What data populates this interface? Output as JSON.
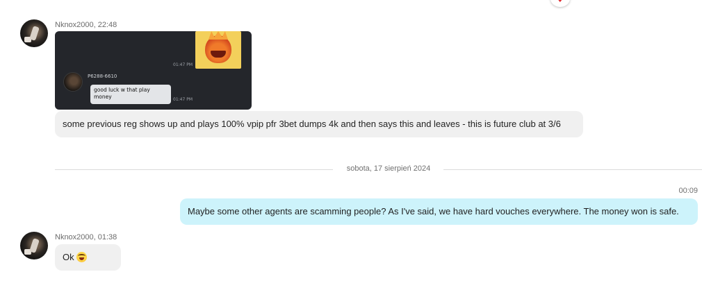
{
  "messages": {
    "first_group": {
      "sender": "Nknox2000, 22:48",
      "screenshot": {
        "time_top": "01:47 PM",
        "inner_name": "P6288-6610",
        "inner_message": "good luck w that play money",
        "time_bottom": "01:47 PM"
      },
      "text": "some previous reg shows up and plays 100% vpip pfr 3bet dumps 4k and then says this and leaves - this is future club at 3/6"
    },
    "date_divider": "sobota, 17 sierpień 2024",
    "outgoing": {
      "time": "00:09",
      "text": "Maybe some other agents are scamming people? As I've said, we have hard vouches everywhere. The money won is safe."
    },
    "second_group": {
      "sender": "Nknox2000, 01:38",
      "text": "Ok"
    }
  },
  "icons": {
    "reaction": "heart-reaction-icon",
    "emoji": "grinning-sweat-emoji-icon"
  },
  "colors": {
    "incoming_bubble": "#f0f0f0",
    "outgoing_bubble": "#cdf3fb",
    "reaction": "#e0282e"
  }
}
